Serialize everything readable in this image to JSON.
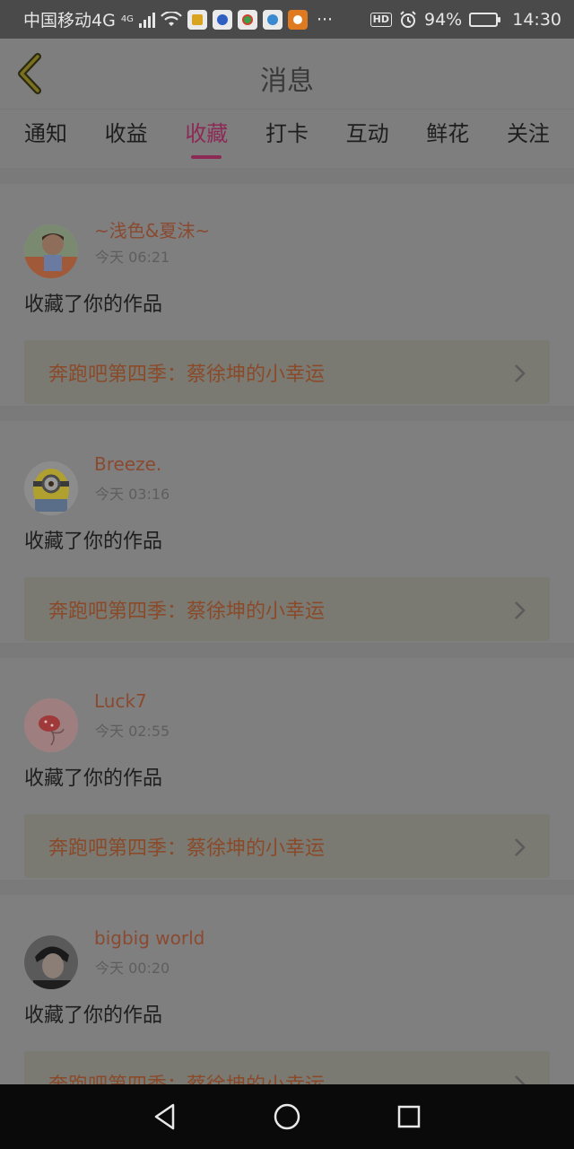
{
  "status_bar": {
    "carrier": "中国移动4G",
    "network_badge": "4G",
    "battery_percent": "94%",
    "battery_level": 0.94,
    "time": "14:30",
    "hd_badge": "HD",
    "more": "···",
    "icons": [
      "signal-icon",
      "wifi-icon",
      "app-notification-icons",
      "alarm-icon",
      "battery-icon"
    ]
  },
  "header": {
    "title": "消息",
    "back_icon": "chevron-left-icon"
  },
  "tabs": [
    {
      "label": "通知",
      "active": false
    },
    {
      "label": "收益",
      "active": false
    },
    {
      "label": "收藏",
      "active": true
    },
    {
      "label": "打卡",
      "active": false
    },
    {
      "label": "互动",
      "active": false
    },
    {
      "label": "鲜花",
      "active": false
    },
    {
      "label": "关注",
      "active": false
    }
  ],
  "notifications": [
    {
      "user": "~浅色&夏沫~",
      "time": "今天 06:21",
      "action": "收藏了你的作品",
      "work": "奔跑吧第四季：蔡徐坤的小幸运"
    },
    {
      "user": "Breeze.",
      "time": "今天 03:16",
      "action": "收藏了你的作品",
      "work": "奔跑吧第四季：蔡徐坤的小幸运"
    },
    {
      "user": "Luck7",
      "time": "今天 02:55",
      "action": "收藏了你的作品",
      "work": "奔跑吧第四季：蔡徐坤的小幸运"
    },
    {
      "user": "bigbig world",
      "time": "今天 00:20",
      "action": "收藏了你的作品",
      "work": "奔跑吧第四季：蔡徐坤的小幸运"
    }
  ],
  "colors": {
    "accent": "#8c2a55",
    "username": "#8a4a30",
    "overlay_bg": "#7f7f7f"
  },
  "nav_bar": {
    "icons": [
      "back-triangle-icon",
      "home-circle-icon",
      "recents-square-icon"
    ]
  }
}
